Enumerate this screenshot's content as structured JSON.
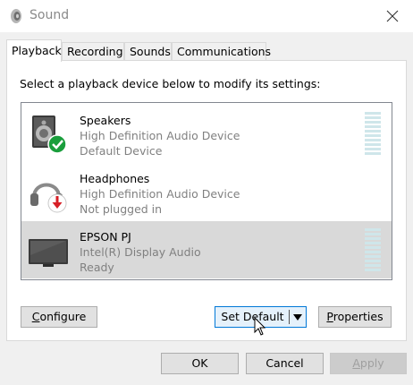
{
  "window": {
    "title": "Sound",
    "icon": "speaker-app-icon",
    "close_icon": "close-icon"
  },
  "tabs": [
    {
      "label": "Playback",
      "active": true
    },
    {
      "label": "Recording",
      "active": false
    },
    {
      "label": "Sounds",
      "active": false
    },
    {
      "label": "Communications",
      "active": false
    }
  ],
  "instruction": "Select a playback device below to modify its settings:",
  "devices": [
    {
      "name": "Speakers",
      "detail": "High Definition Audio Device",
      "status": "Default Device",
      "icon": "speakers-icon",
      "badge": "default-check-badge",
      "selected": false
    },
    {
      "name": "Headphones",
      "detail": "High Definition Audio Device",
      "status": "Not plugged in",
      "icon": "headphones-icon",
      "badge": "unplugged-arrow-badge",
      "selected": false
    },
    {
      "name": "EPSON PJ",
      "detail": "Intel(R) Display Audio",
      "status": "Ready",
      "icon": "monitor-icon",
      "selected": true
    }
  ],
  "buttons": {
    "configure": "Configure",
    "set_default": "Set Default",
    "properties": "Properties",
    "ok": "OK",
    "cancel": "Cancel",
    "apply": "Apply"
  },
  "colors": {
    "check_badge": "#1a9e3c",
    "unplugged_badge": "#d71f26",
    "selection": "#d9d9d9",
    "focus_border": "#0078d7",
    "meter": "#cfe6ea"
  }
}
